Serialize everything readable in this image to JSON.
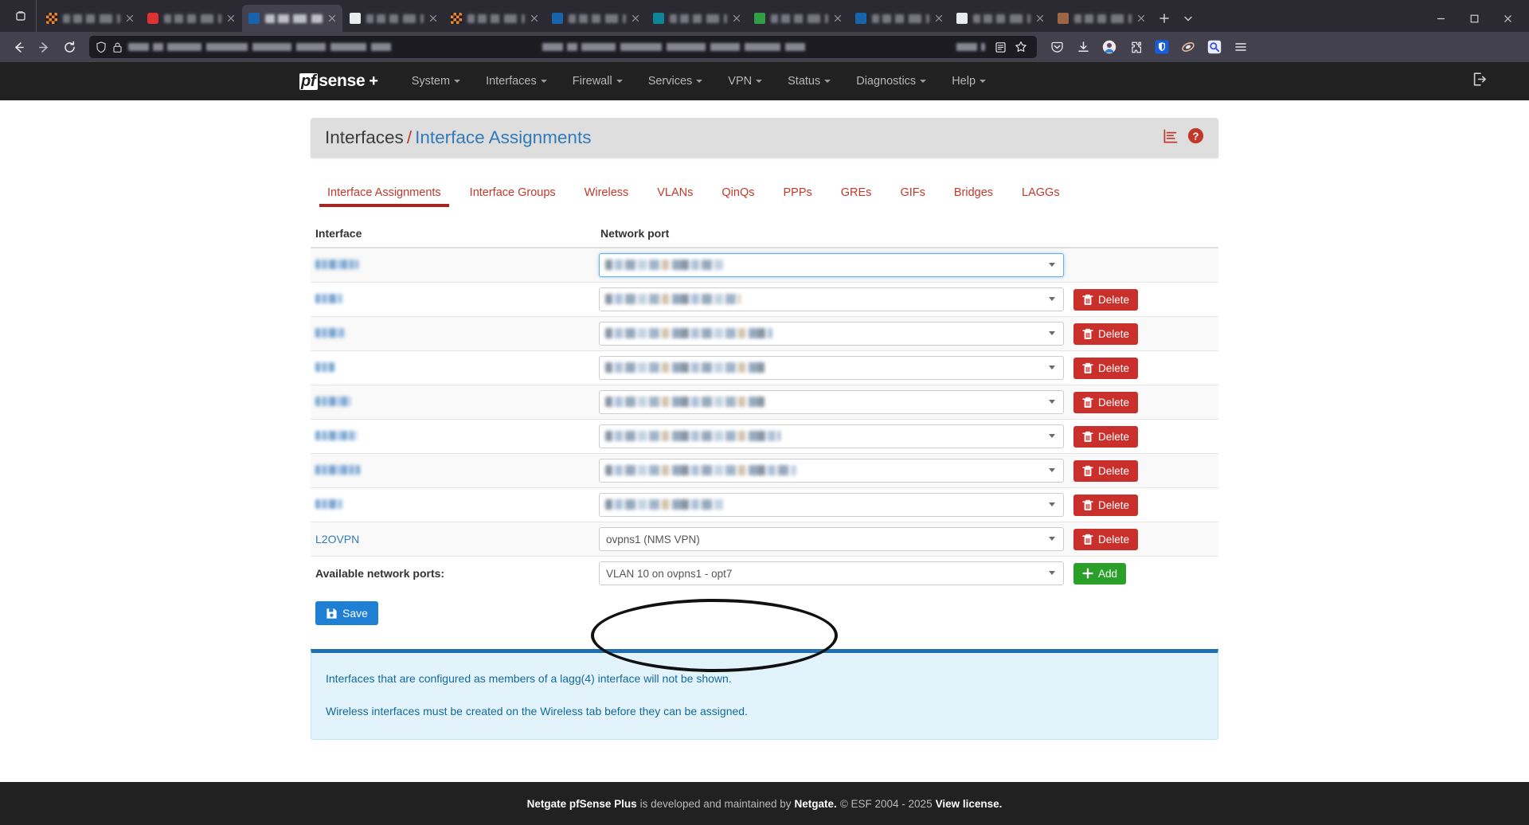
{
  "browser": {
    "tabs": [
      {
        "favicon": "checker-icon",
        "title": "redacted-tab-1",
        "active": false
      },
      {
        "favicon": "red-icon",
        "title": "redacted-tab-2",
        "active": false
      },
      {
        "favicon": "blue-icon",
        "title": "pfsense-redacted",
        "active": true
      },
      {
        "favicon": "white-icon",
        "title": "redacted-tab-4",
        "active": false
      },
      {
        "favicon": "checker-icon",
        "title": "redacted-tab-5",
        "active": false
      },
      {
        "favicon": "blue-icon",
        "title": "redacted-tab-6",
        "active": false
      },
      {
        "favicon": "teal-icon",
        "title": "redacted-tab-7",
        "active": false
      },
      {
        "favicon": "green-icon",
        "title": "redacted-tab-8",
        "active": false
      },
      {
        "favicon": "blue-icon",
        "title": "redacted-tab-9",
        "active": false
      },
      {
        "favicon": "white-icon",
        "title": "redacted-tab-10",
        "active": false
      },
      {
        "favicon": "brown-icon",
        "title": "redacted-tab-11",
        "active": false
      }
    ],
    "url": "redacted-url",
    "nav": {
      "back": "back-icon",
      "forward": "forward-icon",
      "reload": "reload-icon",
      "new_tab": "+",
      "tab_list": "tab-list-icon"
    },
    "toolbar_icons": [
      "pocket-icon",
      "downloads-icon",
      "account-avatar-icon",
      "extensions-icon",
      "bitwarden-shield-icon",
      "puzzle-icon",
      "search-extension-icon",
      "hamburger-menu-icon"
    ],
    "urlbar_icons": [
      "shield-icon",
      "lock-icon"
    ],
    "urlbar_right_icons": [
      "reader-view-icon",
      "bookmark-star-icon"
    ],
    "window_controls": [
      "minimize",
      "maximize",
      "close"
    ]
  },
  "topnav": {
    "brand": {
      "pf": "pf",
      "sense": "sense",
      "plus": "+"
    },
    "items": [
      {
        "label": "System",
        "caret": true
      },
      {
        "label": "Interfaces",
        "caret": true
      },
      {
        "label": "Firewall",
        "caret": true
      },
      {
        "label": "Services",
        "caret": true
      },
      {
        "label": "VPN",
        "caret": true
      },
      {
        "label": "Status",
        "caret": true
      },
      {
        "label": "Diagnostics",
        "caret": true
      },
      {
        "label": "Help",
        "caret": true
      }
    ],
    "logout_icon": "logout-icon"
  },
  "header": {
    "breadcrumb_root": "Interfaces",
    "breadcrumb_sep": "/",
    "breadcrumb_current": "Interface Assignments",
    "icons": [
      "status-bars-icon",
      "help-circle-icon"
    ]
  },
  "tabs": [
    {
      "label": "Interface Assignments",
      "active": true
    },
    {
      "label": "Interface Groups",
      "active": false
    },
    {
      "label": "Wireless",
      "active": false
    },
    {
      "label": "VLANs",
      "active": false
    },
    {
      "label": "QinQs",
      "active": false
    },
    {
      "label": "PPPs",
      "active": false
    },
    {
      "label": "GREs",
      "active": false
    },
    {
      "label": "GIFs",
      "active": false
    },
    {
      "label": "Bridges",
      "active": false
    },
    {
      "label": "LAGGs",
      "active": false
    }
  ],
  "table": {
    "columns": {
      "interface": "Interface",
      "network_port": "Network port"
    },
    "rows": [
      {
        "interface": "",
        "port": "",
        "redacted": true,
        "focused": true,
        "delete": null,
        "blur_w": 54,
        "val_w": 148
      },
      {
        "interface": "",
        "port": "",
        "redacted": true,
        "focused": false,
        "delete": "Delete",
        "blur_w": 34,
        "val_w": 170
      },
      {
        "interface": "",
        "port": "",
        "redacted": true,
        "focused": false,
        "delete": "Delete",
        "blur_w": 36,
        "val_w": 210
      },
      {
        "interface": "",
        "port": "",
        "redacted": true,
        "focused": false,
        "delete": "Delete",
        "blur_w": 24,
        "val_w": 200
      },
      {
        "interface": "",
        "port": "",
        "redacted": true,
        "focused": false,
        "delete": "Delete",
        "blur_w": 44,
        "val_w": 200
      },
      {
        "interface": "",
        "port": "",
        "redacted": true,
        "focused": false,
        "delete": "Delete",
        "blur_w": 52,
        "val_w": 220
      },
      {
        "interface": "",
        "port": "",
        "redacted": true,
        "focused": false,
        "delete": "Delete",
        "blur_w": 56,
        "val_w": 240
      },
      {
        "interface": "",
        "port": "",
        "redacted": true,
        "focused": false,
        "delete": "Delete",
        "blur_w": 34,
        "val_w": 150
      },
      {
        "interface": "L2OVPN",
        "port": "ovpns1 (NMS VPN)",
        "redacted": false,
        "focused": false,
        "delete": "Delete",
        "blur_w": 0,
        "val_w": 0
      }
    ],
    "available_label": "Available network ports:",
    "available_value": "VLAN 10 on ovpns1 - opt7",
    "add_label": "Add",
    "save_label": "Save"
  },
  "info": {
    "line1": "Interfaces that are configured as members of a lagg(4) interface will not be shown.",
    "line2": "Wireless interfaces must be created on the Wireless tab before they can be assigned."
  },
  "footer": {
    "brand": "Netgate pfSense Plus",
    "mid": " is developed and maintained by ",
    "company": "Netgate.",
    "copyright": " © ESF 2004 - 2025 ",
    "license": "View license."
  },
  "annotation": {
    "shape": "ellipse-highlight",
    "target": "network-port-selects"
  },
  "colors": {
    "accent_red": "#c0392b",
    "link_blue": "#337ab7",
    "save_blue": "#1f7fd4",
    "delete_red": "#c9302c",
    "add_green": "#2aa02a",
    "info_bg": "#e2f3fb",
    "info_border": "#1f6fb2",
    "nav_dark": "#212121"
  }
}
